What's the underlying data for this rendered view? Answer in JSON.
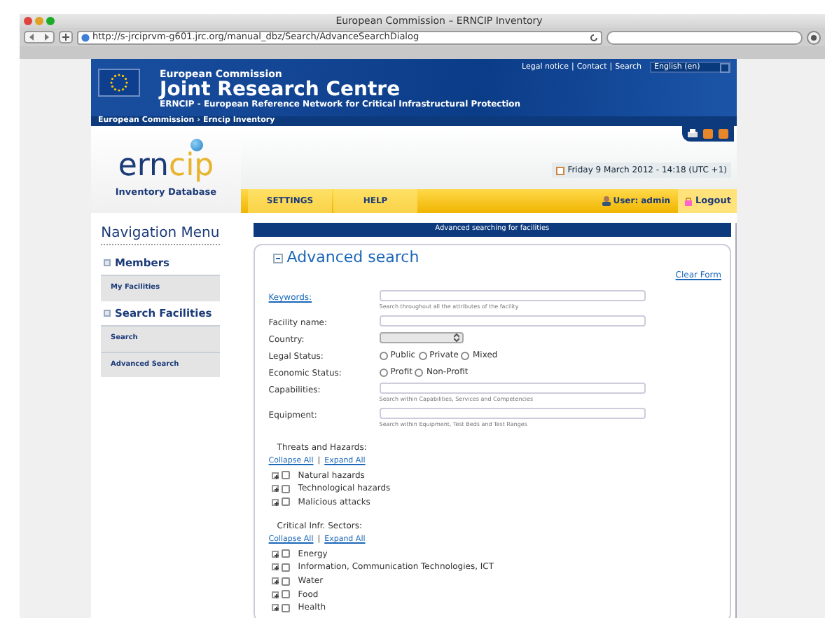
{
  "window": {
    "title": "European Commission – ERNCIP Inventory"
  },
  "toolbar": {
    "url": "http://s-jrciprvm-g601.jrc.org/manual_dbz/Search/AdvanceSearchDialog"
  },
  "header": {
    "org": "European Commission",
    "title": "Joint Research Centre",
    "subtitle": "ERNCIP - European Reference Network for Critical Infrastructural Protection",
    "links": [
      "Legal notice",
      "Contact",
      "Search"
    ],
    "link_separator": "|",
    "breadcrumb_separator": "›",
    "language": "English (en)",
    "breadcrumb": [
      "European Commission",
      "Erncip Inventory"
    ]
  },
  "logo": {
    "part_1": "ern",
    "part_2": "cip",
    "caption": "Inventory Database"
  },
  "date": "Friday 9 March 2012 - 14:18 (UTC +1)",
  "menu": [
    "SETTINGS",
    "HELP"
  ],
  "user": {
    "label": "User:",
    "name": "admin"
  },
  "logout": "Logout",
  "sidebar": {
    "title": "Navigation Menu",
    "sections": [
      {
        "label": "Members",
        "items": [
          "My Facilities"
        ]
      },
      {
        "label": "Search Facilities",
        "items": [
          "Search",
          "Advanced Search"
        ]
      }
    ]
  },
  "form": {
    "banner": "Advanced searching for facilities",
    "legend": "Advanced search",
    "clear": "Clear Form",
    "fields": [
      {
        "kind": "text",
        "label": "Keywords:",
        "link": true,
        "hint": "Search throughout all the attributes of the facility"
      },
      {
        "kind": "text",
        "label": "Facility name:",
        "link": false
      },
      {
        "kind": "select",
        "label": "Country:",
        "link": false
      },
      {
        "kind": "radio",
        "label": "Legal Status:",
        "link": false,
        "options": [
          {
            "label": "Public",
            "selected": false
          },
          {
            "label": "Private",
            "selected": false
          },
          {
            "label": "Mixed",
            "selected": false
          }
        ]
      },
      {
        "kind": "radio",
        "label": "Economic Status:",
        "link": false,
        "options": [
          {
            "label": "Profit",
            "selected": false
          },
          {
            "label": "Non-Profit",
            "selected": false
          }
        ]
      },
      {
        "kind": "text",
        "label": "Capabilities:",
        "link": false,
        "hint": "Search within Capabilities, Services and Competencies"
      },
      {
        "kind": "text",
        "label": "Equipment:",
        "link": false,
        "hint": "Search within Equipment, Test Beds and Test Ranges"
      }
    ],
    "trees": [
      {
        "title": "Threats and Hazards:",
        "collapse": "Collapse All",
        "separator": "|",
        "expand": "Expand All",
        "items": [
          {
            "label": "Natural hazards",
            "checked": false,
            "expanded": false
          },
          {
            "label": "Technological hazards",
            "checked": false,
            "expanded": false
          },
          {
            "label": "Malicious attacks",
            "checked": false,
            "expanded": false
          }
        ]
      },
      {
        "title": "Critical Infr. Sectors:",
        "collapse": "Collapse All",
        "separator": "|",
        "expand": "Expand All",
        "items": [
          {
            "label": "Energy",
            "checked": false,
            "expanded": false
          },
          {
            "label": "Information, Communication Technologies, ICT",
            "checked": false,
            "expanded": false
          },
          {
            "label": "Water",
            "checked": false,
            "expanded": false
          },
          {
            "label": "Food",
            "checked": false,
            "expanded": false
          },
          {
            "label": "Health",
            "checked": false,
            "expanded": false
          }
        ]
      }
    ]
  }
}
